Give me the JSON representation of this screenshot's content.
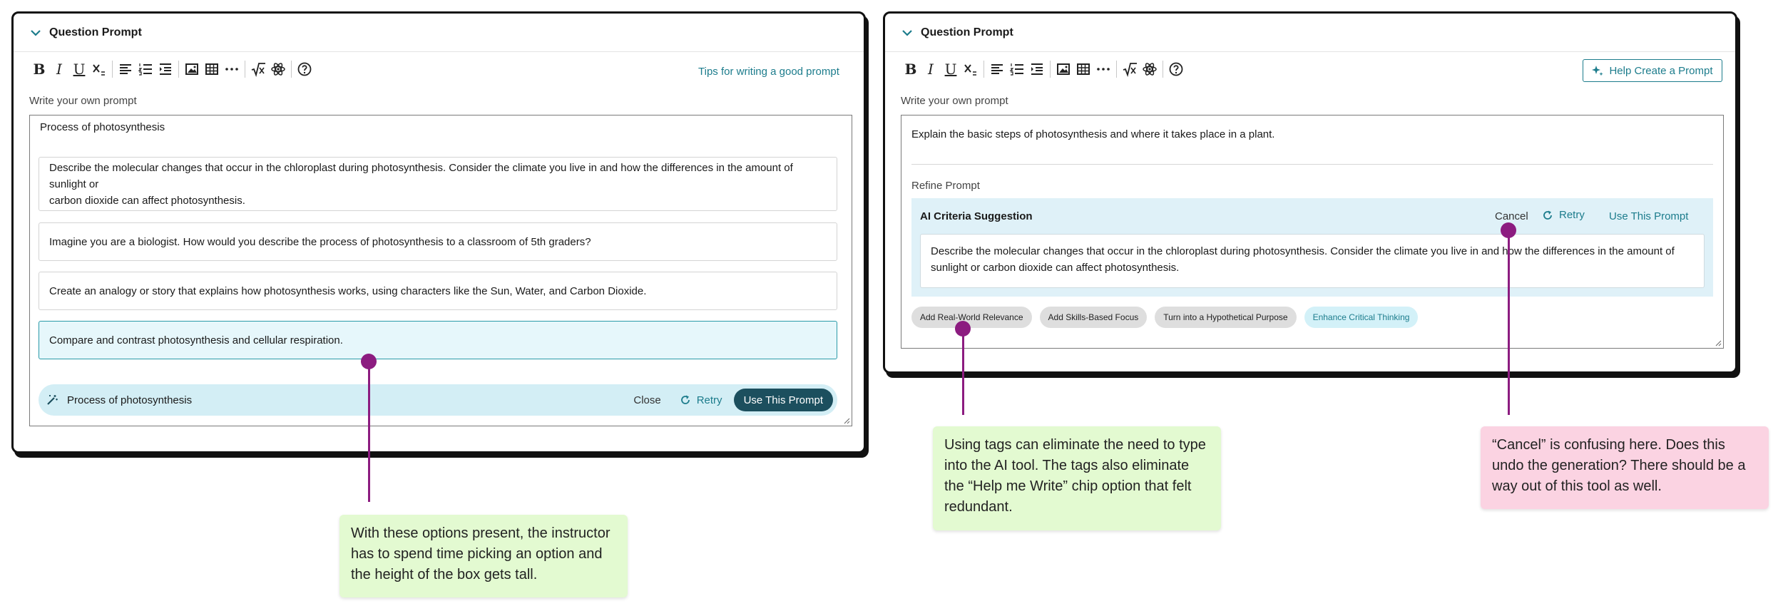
{
  "left_panel": {
    "title": "Question Prompt",
    "tips_link": "Tips for writing a good prompt",
    "write_label": "Write your own prompt",
    "prompt_text": "Process of photosynthesis",
    "options": [
      {
        "line1": "Describe the molecular changes that occur in the chloroplast during photosynthesis. Consider the climate you live in and how the differences in the amount of sunlight or",
        "line2": "carbon dioxide can affect photosynthesis."
      },
      {
        "line1": "Imagine you are a biologist. How would you describe the process of photosynthesis to a classroom of 5th graders?"
      },
      {
        "line1": "Create an analogy or story that explains how photosynthesis works, using characters like the Sun, Water, and Carbon Dioxide."
      },
      {
        "line1": "Compare and contrast photosynthesis and cellular respiration.",
        "selected": true
      }
    ],
    "ai_bar": {
      "text": "Process of photosynthesis",
      "close_label": "Close",
      "retry_label": "Retry",
      "use_label": "Use This Prompt"
    }
  },
  "right_panel": {
    "title": "Question Prompt",
    "help_button": "Help Create a Prompt",
    "write_label": "Write your own prompt",
    "prompt_text": "Explain the basic steps of photosynthesis and where it takes place in a plant.",
    "refine_label": "Refine Prompt",
    "ai_criteria": {
      "title": "AI Criteria Suggestion",
      "cancel_label": "Cancel",
      "retry_label": "Retry",
      "use_label": "Use This Prompt",
      "line1": "Describe the molecular changes that occur in the chloroplast during photosynthesis. Consider the climate you live in and how the differences in the amount of",
      "line2": "sunlight or carbon dioxide can affect photosynthesis."
    },
    "tags": [
      {
        "label": "Add Real-World Relevance"
      },
      {
        "label": "Add Skills-Based Focus"
      },
      {
        "label": "Turn into a Hypothetical Purpose"
      },
      {
        "label": "Enhance Critical Thinking",
        "active": true
      }
    ]
  },
  "callouts": [
    {
      "text": "With these options present, the instructor has to spend time picking an option and the height of the box gets tall.",
      "color": "#e3fad1"
    },
    {
      "text": "Using tags can eliminate the need to type into the AI tool. The tags also eliminate the “Help me Write” chip option that felt redundant.",
      "color": "#e3fad1"
    },
    {
      "text": "“Cancel” is confusing here. Does this undo the generation? There should be a way out of this tool as well.",
      "color": "#fbd3e2"
    }
  ],
  "colors": {
    "accent": "#1c7c8c",
    "primary_button": "#1c4f5e",
    "ai_highlight": "#d3eef5",
    "pin": "#8c1c80"
  },
  "icons": {
    "collapse": "chevron-down-icon",
    "ai_bar": "magic-wand-icon",
    "retry": "refresh-icon",
    "help": "sparkle-icon"
  }
}
